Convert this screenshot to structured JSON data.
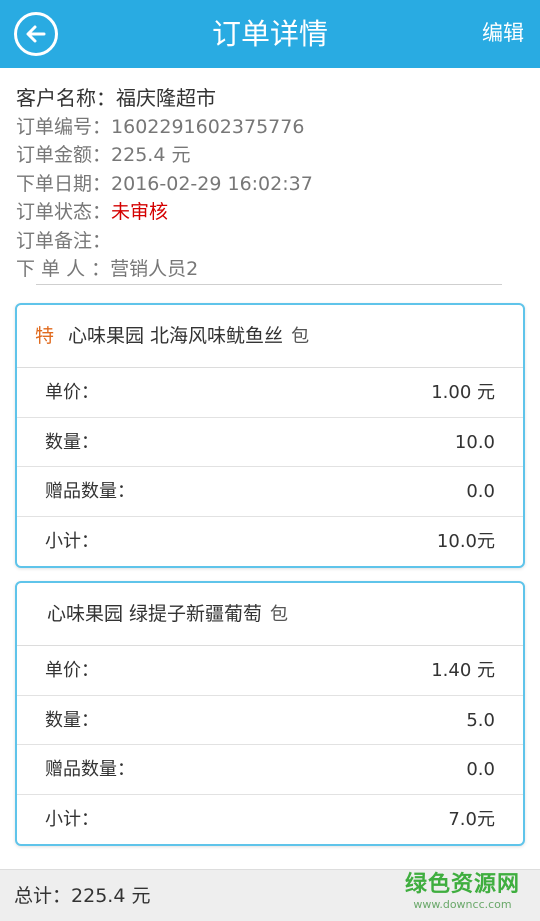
{
  "header": {
    "title": "订单详情",
    "edit_label": "编辑",
    "bg_color": "#29abe2"
  },
  "order": {
    "customer_label": "客户名称：",
    "customer_value": "福庆隆超市",
    "number_label": "订单编号：",
    "number_value": "1602291602375776",
    "amount_label": "订单金额：",
    "amount_value": "225.4 元",
    "date_label": "下单日期：",
    "date_value": "2016-02-29 16:02:37",
    "status_label": "订单状态：",
    "status_value": "未审核",
    "status_color": "#d40000",
    "remark_label": "订单备注：",
    "remark_value": "",
    "placer_label": "下 单 人 ：",
    "placer_value": "营销人员2"
  },
  "products": [
    {
      "tag": "特",
      "name": "心味果园 北海风味鱿鱼丝",
      "unit": "包",
      "rows": [
        {
          "label": "单价：",
          "value": "1.00 元"
        },
        {
          "label": "数量：",
          "value": "10.0"
        },
        {
          "label": "赠品数量：",
          "value": "0.0"
        },
        {
          "label": "小计：",
          "value": "10.0元"
        }
      ]
    },
    {
      "tag": "",
      "name": "心味果园 绿提子新疆葡萄",
      "unit": "包",
      "rows": [
        {
          "label": "单价：",
          "value": "1.40 元"
        },
        {
          "label": "数量：",
          "value": "5.0"
        },
        {
          "label": "赠品数量：",
          "value": "0.0"
        },
        {
          "label": "小计：",
          "value": "7.0元"
        }
      ]
    }
  ],
  "footer": {
    "total_label": "总计：",
    "total_value": "225.4 元"
  },
  "watermark": {
    "main": "绿色资源网",
    "sub": "www.downcc.com"
  }
}
